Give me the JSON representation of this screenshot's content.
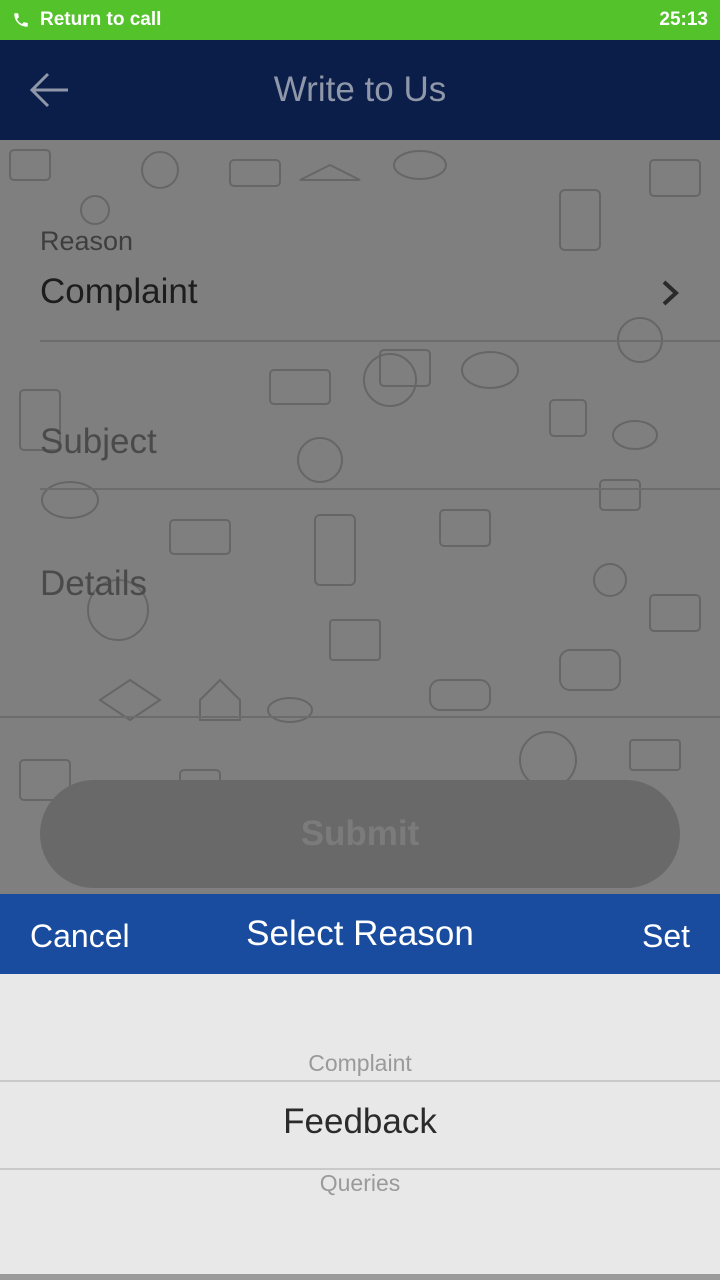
{
  "status_bar": {
    "call_text": "Return to call",
    "time": "25:13",
    "bg_color": "#53c22b"
  },
  "header": {
    "title": "Write to Us",
    "back_icon": "arrow-left-icon",
    "bg_color": "#0b1e4a"
  },
  "form": {
    "reason_label": "Reason",
    "reason_value": "Complaint",
    "subject_placeholder": "Subject",
    "details_placeholder": "Details",
    "submit_label": "Submit"
  },
  "picker": {
    "cancel_label": "Cancel",
    "title": "Select Reason",
    "set_label": "Set",
    "options": [
      "Complaint",
      "Feedback",
      "Queries"
    ],
    "selected": "Feedback",
    "toolbar_color": "#194b9e"
  }
}
